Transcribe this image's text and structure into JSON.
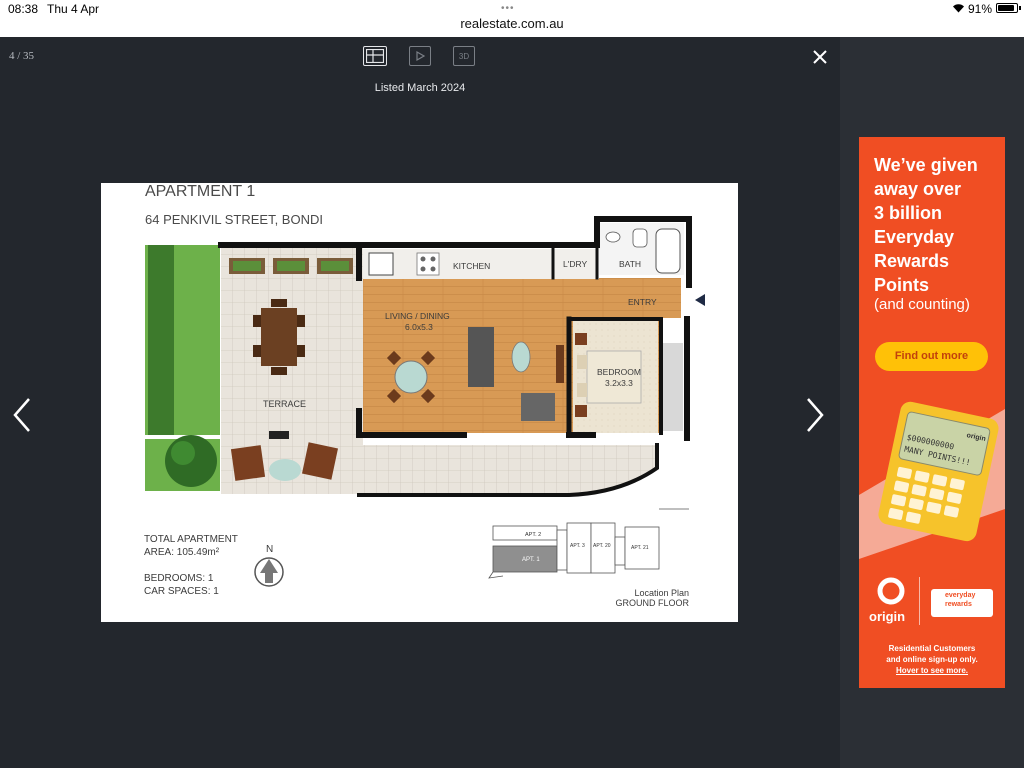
{
  "status_bar": {
    "time": "08:38",
    "date": "Thu 4 Apr",
    "url": "realestate.com.au",
    "battery": "91%",
    "battery_level": 0.91
  },
  "gallery": {
    "counter": "4 / 35",
    "listed": "Listed March 2024",
    "view_buttons": [
      "floorplan-icon",
      "video-icon",
      "3D"
    ],
    "active_view": "floorplan"
  },
  "floorplan": {
    "title": "APARTMENT 1",
    "address": "64 PENKIVIL STREET, BONDI",
    "rooms": {
      "kitchen": "KITCHEN",
      "laundry": "L'DRY",
      "bath": "BATH",
      "entry": "ENTRY",
      "living": "LIVING / DINING",
      "living_size": "6.0x5.3",
      "bedroom": "BEDROOM",
      "bedroom_size": "3.2x3.3",
      "terrace": "TERRACE"
    },
    "total_line1": "TOTAL APARTMENT",
    "total_line2": "AREA: 105.49m²",
    "bedrooms": "BEDROOMS: 1",
    "car_spaces": "CAR SPACES: 1",
    "north": "N",
    "location_plan": "Location Plan",
    "ground_floor": "GROUND FLOOR",
    "apt_labels": [
      "APT. 2",
      "APT. 1",
      "APT. 3",
      "APT. 20",
      "APT. 21"
    ]
  },
  "ad": {
    "headline": [
      "We’ve given",
      "away over",
      "3 billion",
      "Everyday",
      "Rewards",
      "Points"
    ],
    "subline": "(and counting)",
    "cta": "Find out more",
    "calc_display": [
      "$000000000",
      "MANY POINTS!!!"
    ],
    "calc_brand": "origin",
    "origin_word": "origin",
    "rewards_logo": [
      "everyday",
      "rewards"
    ],
    "fine_print": [
      "Residential Customers",
      "and online sign-up only.",
      "Hover to see more."
    ],
    "colors": {
      "background": "#f04e23",
      "cta": "#ffc107"
    }
  }
}
